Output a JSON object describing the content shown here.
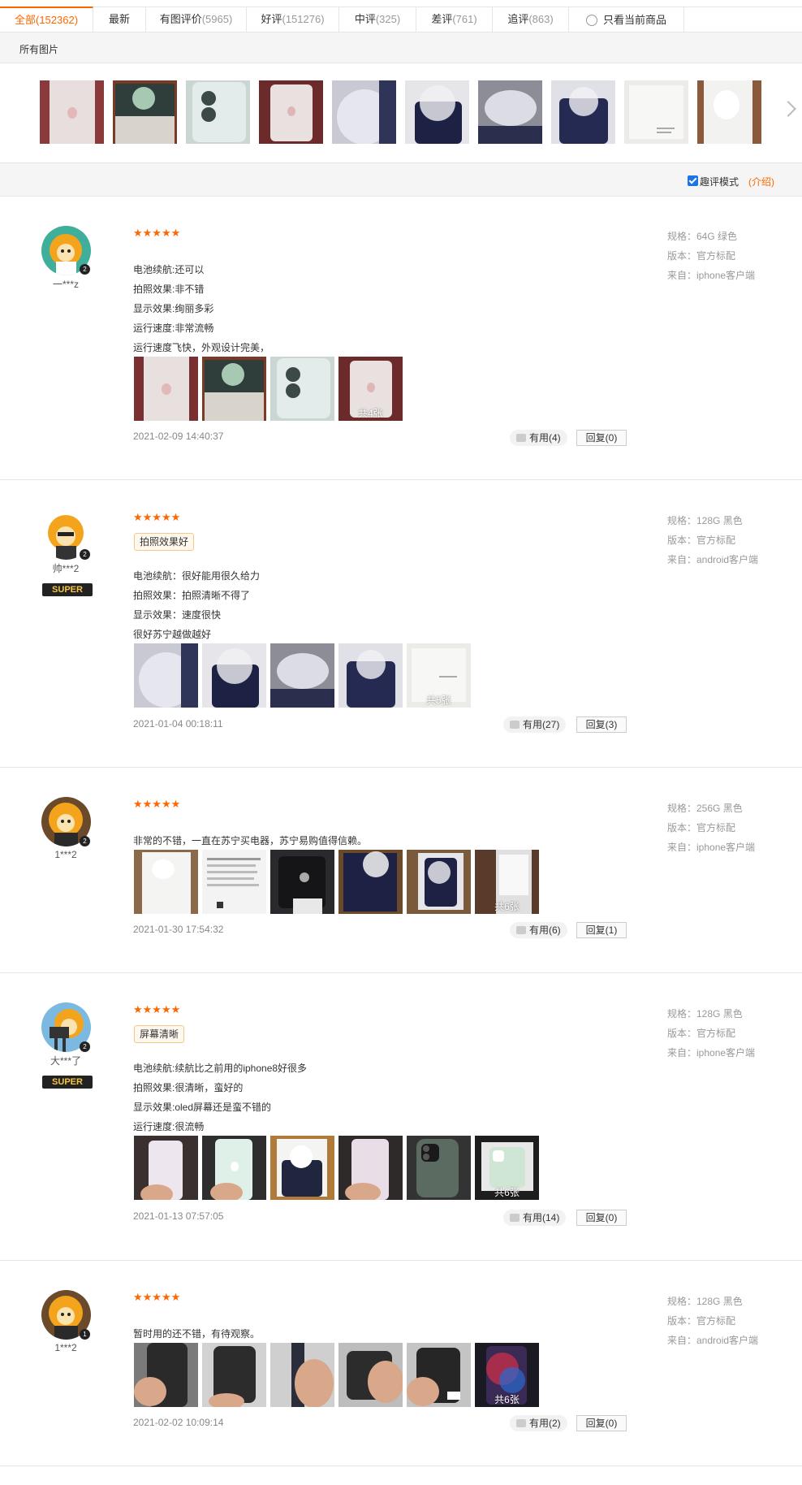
{
  "tabs": [
    {
      "label": "全部",
      "count": "(152362)"
    },
    {
      "label": "最新",
      "count": ""
    },
    {
      "label": "有图评价",
      "count": "(5965)"
    },
    {
      "label": "好评",
      "count": "(151276)"
    },
    {
      "label": "中评",
      "count": "(325)"
    },
    {
      "label": "差评",
      "count": "(761)"
    },
    {
      "label": "追评",
      "count": "(863)"
    },
    {
      "label": "只看当前商品",
      "count": ""
    }
  ],
  "all_pics_label": "所有图片",
  "mode": {
    "label": "趣评模式",
    "intro": "(介绍)"
  },
  "reviews": [
    {
      "user": "一***z",
      "vip": "2",
      "stars": "★★★★★",
      "lines": [
        "电池续航:还可以",
        "拍照效果:非不错",
        "显示效果:绚丽多彩",
        "运行速度:非常流畅",
        "运行速度飞快，外观设计完美，"
      ],
      "pic_total": "共4张",
      "date": "2021-02-09 14:40:37",
      "useful": "有用(4)",
      "reply": "回复(0)",
      "spec": "规格：64G 绿色",
      "version": "版本：官方标配",
      "from": "来自：iphone客户端"
    },
    {
      "user": "帅***2",
      "vip": "2",
      "super": "SUPER",
      "stars": "★★★★★",
      "tag": "拍照效果好",
      "lines": [
        "电池续航：很好能用很久给力",
        "拍照效果：拍照清晰不得了",
        "显示效果：速度很快",
        "很好苏宁越做越好"
      ],
      "pic_total": "共5张",
      "date": "2021-01-04 00:18:11",
      "useful": "有用(27)",
      "reply": "回复(3)",
      "spec": "规格：128G 黑色",
      "version": "版本：官方标配",
      "from": "来自：android客户端"
    },
    {
      "user": "1***2",
      "vip": "2",
      "stars": "★★★★★",
      "lines": [
        "非常的不错，一直在苏宁买电器，苏宁易购值得信赖。"
      ],
      "pic_total": "共6张",
      "date": "2021-01-30 17:54:32",
      "useful": "有用(6)",
      "reply": "回复(1)",
      "spec": "规格：256G 黑色",
      "version": "版本：官方标配",
      "from": "来自：iphone客户端"
    },
    {
      "user": "大***了",
      "vip": "2",
      "super": "SUPER",
      "stars": "★★★★★",
      "tag": "屏幕清晰",
      "lines": [
        "电池续航:续航比之前用的iphone8好很多",
        "拍照效果:很清晰，蛮好的",
        "显示效果:oled屏幕还是蛮不错的",
        "运行速度:很流畅"
      ],
      "pic_total": "共6张",
      "date": "2021-01-13 07:57:05",
      "useful": "有用(14)",
      "reply": "回复(0)",
      "spec": "规格：128G 黑色",
      "version": "版本：官方标配",
      "from": "来自：iphone客户端"
    },
    {
      "user": "1***2",
      "vip": "1",
      "stars": "★★★★★",
      "lines": [
        "暂时用的还不错，有待观察。"
      ],
      "pic_total": "共6张",
      "date": "2021-02-02 10:09:14",
      "useful": "有用(2)",
      "reply": "回复(0)",
      "spec": "规格：128G 黑色",
      "version": "版本：官方标配",
      "from": "来自：android客户端"
    }
  ],
  "colors": {
    "accent": "#ff6600",
    "border": "#e5e5e5",
    "muted": "#999999"
  }
}
